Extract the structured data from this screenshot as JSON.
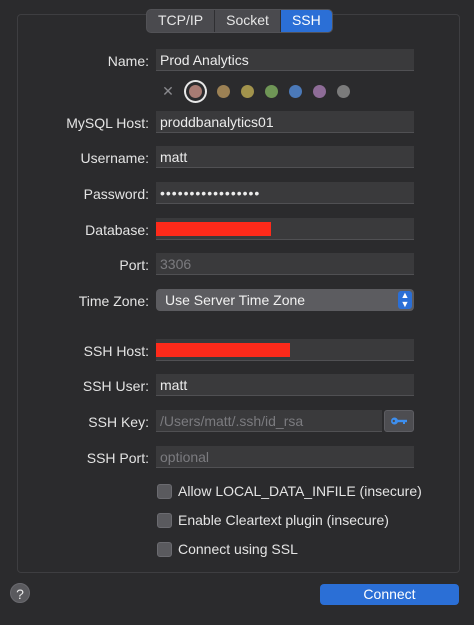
{
  "tabs": [
    {
      "label": "TCP/IP",
      "active": false
    },
    {
      "label": "Socket",
      "active": false
    },
    {
      "label": "SSH",
      "active": true
    }
  ],
  "form": {
    "name": {
      "label": "Name:",
      "value": "Prod Analytics"
    },
    "mysql_host": {
      "label": "MySQL Host:",
      "value": "proddbanalytics01"
    },
    "username": {
      "label": "Username:",
      "value": "matt"
    },
    "password": {
      "label": "Password:",
      "value": "•••••••••••••••••"
    },
    "database": {
      "label": "Database:",
      "value": "",
      "redacted": true
    },
    "port": {
      "label": "Port:",
      "placeholder": "3306"
    },
    "time_zone": {
      "label": "Time Zone:",
      "value": "Use Server Time Zone"
    },
    "ssh_host": {
      "label": "SSH Host:",
      "value": "",
      "redacted": true
    },
    "ssh_user": {
      "label": "SSH User:",
      "value": "matt"
    },
    "ssh_key": {
      "label": "SSH Key:",
      "placeholder": "/Users/matt/.ssh/id_rsa"
    },
    "ssh_port": {
      "label": "SSH Port:",
      "placeholder": "optional"
    }
  },
  "colors": {
    "none_icon": "x-icon",
    "swatches": [
      "#a87b73",
      "#9c8154",
      "#a2934c",
      "#6f9656",
      "#4b79b8",
      "#8e6c97",
      "#7b7b7b"
    ],
    "selected_index": 0
  },
  "checkboxes": [
    {
      "label": "Allow LOCAL_DATA_INFILE (insecure)",
      "checked": false
    },
    {
      "label": "Enable Cleartext plugin (insecure)",
      "checked": false
    },
    {
      "label": "Connect using SSL",
      "checked": false
    }
  ],
  "footer": {
    "help": "?",
    "connect": "Connect"
  },
  "accent": "#2b6fd6",
  "redaction_color": "#ff2a1a"
}
